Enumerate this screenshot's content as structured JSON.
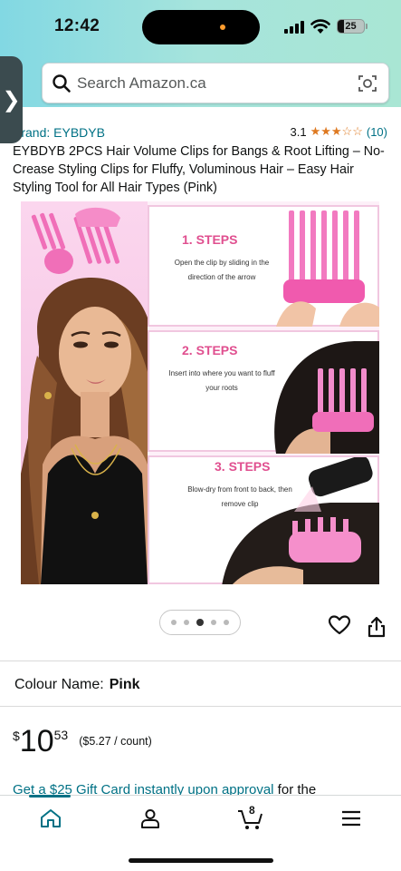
{
  "status_bar": {
    "time": "12:42",
    "battery": "25"
  },
  "search": {
    "placeholder": "Search Amazon.ca"
  },
  "side_tab": {
    "glyph": "❯"
  },
  "product": {
    "brand": "Brand: EYBDYB",
    "rating_value": "3.1",
    "rating_stars": "★★★☆☆",
    "rating_stars_value": 3.1,
    "rating_count": "(10)",
    "title": "EYBDYB 2PCS Hair Volume Clips for Bangs & Root Lifting – No-Crease Styling Clips for Fluffy, Voluminous Hair – Easy Hair Styling Tool for All Hair Types (Pink)"
  },
  "image": {
    "steps": [
      {
        "label": "1. STEPS",
        "desc": "Open the clip by sliding in the direction of the arrow"
      },
      {
        "label": "2. STEPS",
        "desc": "Insert into where you want to fluff your roots"
      },
      {
        "label": "3. STEPS",
        "desc": "Blow-dry from front to back, then remove clip"
      }
    ],
    "carousel_active_index": 2,
    "carousel_count": 5
  },
  "options": {
    "colour_label": "Colour Name:",
    "colour_value": "Pink"
  },
  "price": {
    "symbol": "$",
    "whole": "10",
    "fraction": "53",
    "unit": "($5.27 / count)"
  },
  "promo": {
    "link_text": "Get a $25 Gift Card instantly upon approval",
    "tail_text": " for the"
  },
  "nav": {
    "cart_count": "8",
    "active": "home"
  },
  "colors": {
    "accent": "#007185",
    "star": "#de7921",
    "step_pink": "#e04f8f"
  }
}
